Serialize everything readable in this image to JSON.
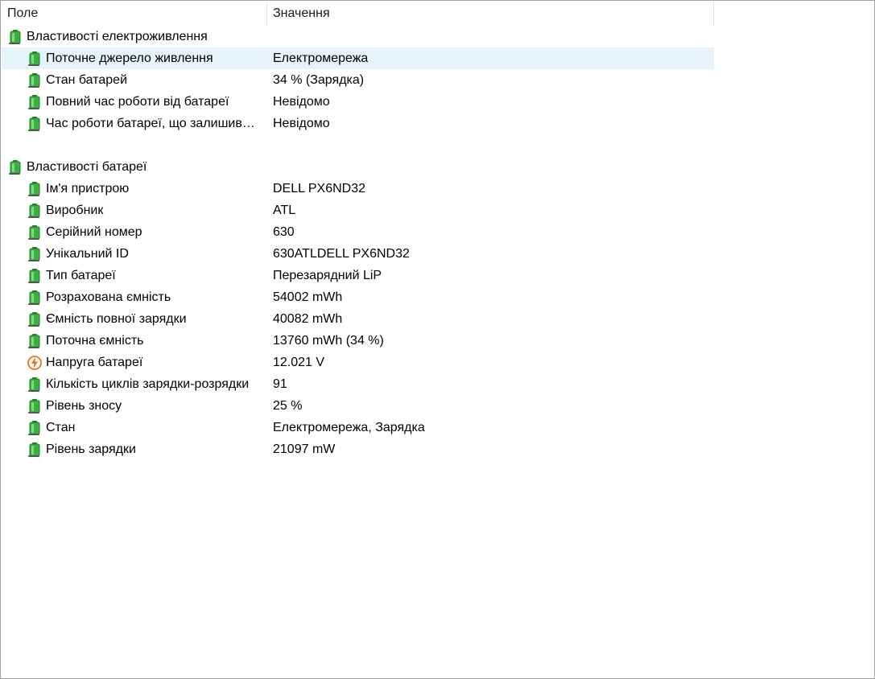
{
  "columns": {
    "field": "Поле",
    "value": "Значення"
  },
  "groups": [
    {
      "title": "Властивості електроживлення",
      "icon": "battery-icon",
      "items": [
        {
          "field": "Поточне джерело живлення",
          "value": "Електромережа",
          "icon": "battery-icon",
          "selected": true
        },
        {
          "field": "Стан батарей",
          "value": "34 % (Зарядка)",
          "icon": "battery-icon"
        },
        {
          "field": "Повний час роботи від батареї",
          "value": "Невідомо",
          "icon": "battery-icon"
        },
        {
          "field": "Час роботи батареї, що залишив…",
          "value": "Невідомо",
          "icon": "battery-icon"
        }
      ]
    },
    {
      "title": "Властивості батареї",
      "icon": "battery-icon",
      "items": [
        {
          "field": "Ім'я пристрою",
          "value": "DELL PX6ND32",
          "icon": "battery-icon"
        },
        {
          "field": "Виробник",
          "value": "ATL",
          "icon": "battery-icon"
        },
        {
          "field": "Серійний номер",
          "value": "630",
          "icon": "battery-icon"
        },
        {
          "field": "Унікальний ID",
          "value": "630ATLDELL PX6ND32",
          "icon": "battery-icon"
        },
        {
          "field": "Тип батареї",
          "value": "Перезарядний LiP",
          "icon": "battery-icon"
        },
        {
          "field": "Розрахована ємність",
          "value": "54002 mWh",
          "icon": "battery-icon"
        },
        {
          "field": "Ємність повної зарядки",
          "value": "40082 mWh",
          "icon": "battery-icon"
        },
        {
          "field": "Поточна ємність",
          "value": "13760 mWh  (34 %)",
          "icon": "battery-icon"
        },
        {
          "field": "Напруга батареї",
          "value": "12.021 V",
          "icon": "voltage-icon"
        },
        {
          "field": "Кількість циклів зарядки-розрядки",
          "value": "91",
          "icon": "battery-icon"
        },
        {
          "field": "Рівень зносу",
          "value": "25 %",
          "icon": "battery-icon"
        },
        {
          "field": "Стан",
          "value": "Електромережа, Зарядка",
          "icon": "battery-icon"
        },
        {
          "field": "Рівень зарядки",
          "value": "21097 mW",
          "icon": "battery-icon"
        }
      ]
    }
  ],
  "colors": {
    "selection": "#e5f3fb",
    "battery_green": "#3cb043",
    "voltage_orange": "#e8731a"
  }
}
